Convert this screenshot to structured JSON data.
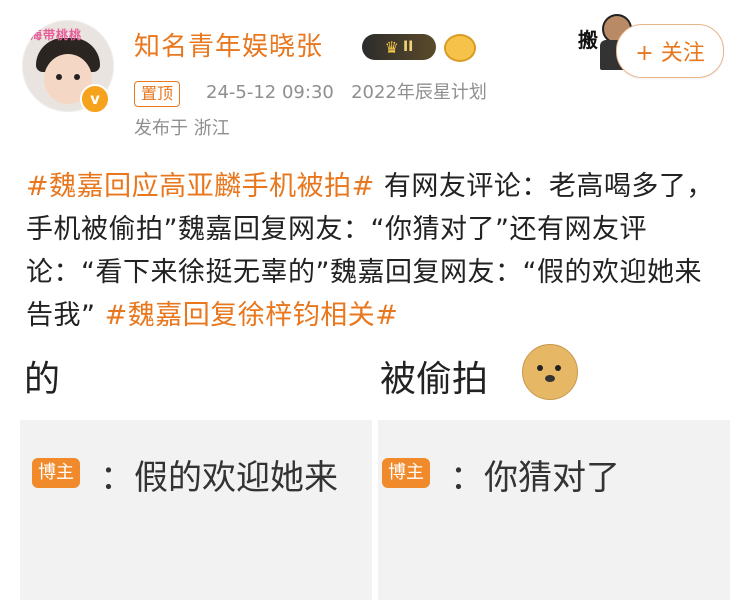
{
  "header": {
    "username": "知名青年娱晓张",
    "level_badge": "II",
    "pin_label": "置顶",
    "timestamp": "24-5-12 09:30",
    "source": "2022年辰星计划",
    "location": "发布于 浙江",
    "follow_label": "+ 关注",
    "sticker_text": "搬",
    "verified_mark": "v",
    "avatar_deco_text": "海带桃桃"
  },
  "post": {
    "hashtag1": "#魏嘉回应高亚麟手机被拍#",
    "body": " 有网友评论：老高喝多了，手机被偷拍”魏嘉回复网友：“你猜对了”还有网友评论：“看下来徐挺无辜的”魏嘉回复网友：“假的欢迎她来告我” ",
    "hashtag2": "#魏嘉回复徐梓钧相关#"
  },
  "screenshots": {
    "left_fragment": "的",
    "right_fragment": "被偷拍",
    "blogger_tag": "博主",
    "left_reply": "：假的欢迎她来",
    "right_reply": "：你猜对了"
  },
  "colors": {
    "accent": "#e8771e",
    "meta": "#8f8f8f",
    "blogger_tag_bg": "#f08a2a"
  }
}
